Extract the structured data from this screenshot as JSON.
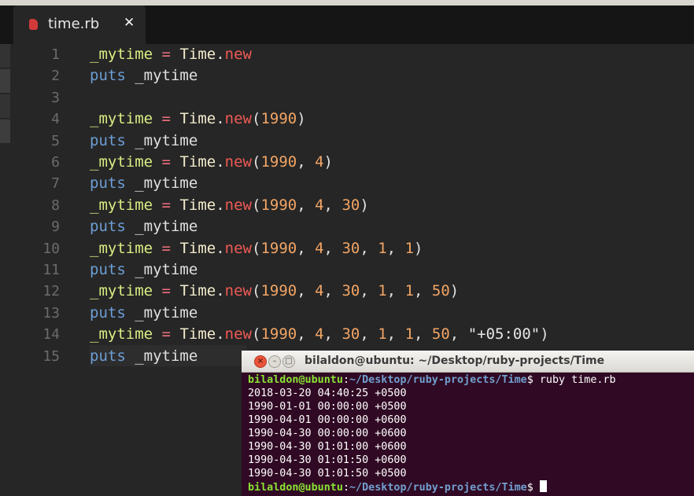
{
  "editor": {
    "tab": {
      "title": "time.rb",
      "close_glyph": "✕"
    },
    "line_numbers": [
      "1",
      "2",
      "3",
      "4",
      "5",
      "6",
      "7",
      "8",
      "9",
      "10",
      "11",
      "12",
      "13",
      "14",
      "15"
    ],
    "lines": [
      [
        [
          "v",
          "_mytime"
        ],
        [
          "p",
          " "
        ],
        [
          "o",
          "="
        ],
        [
          "p",
          " "
        ],
        [
          "c",
          "Time"
        ],
        [
          "p",
          "."
        ],
        [
          "m",
          "new"
        ]
      ],
      [
        [
          "k",
          "puts"
        ],
        [
          "p",
          " _mytime"
        ]
      ],
      [],
      [
        [
          "v",
          "_mytime"
        ],
        [
          "p",
          " "
        ],
        [
          "o",
          "="
        ],
        [
          "p",
          " "
        ],
        [
          "c",
          "Time"
        ],
        [
          "p",
          "."
        ],
        [
          "m",
          "new"
        ],
        [
          "p",
          "("
        ],
        [
          "n",
          "1990"
        ],
        [
          "p",
          ")"
        ]
      ],
      [
        [
          "k",
          "puts"
        ],
        [
          "p",
          " _mytime"
        ]
      ],
      [
        [
          "v",
          "_mytime"
        ],
        [
          "p",
          " "
        ],
        [
          "o",
          "="
        ],
        [
          "p",
          " "
        ],
        [
          "c",
          "Time"
        ],
        [
          "p",
          "."
        ],
        [
          "m",
          "new"
        ],
        [
          "p",
          "("
        ],
        [
          "n",
          "1990"
        ],
        [
          "p",
          ", "
        ],
        [
          "n",
          "4"
        ],
        [
          "p",
          ")"
        ]
      ],
      [
        [
          "k",
          "puts"
        ],
        [
          "p",
          " _mytime"
        ]
      ],
      [
        [
          "v",
          "_mytime"
        ],
        [
          "p",
          " "
        ],
        [
          "o",
          "="
        ],
        [
          "p",
          " "
        ],
        [
          "c",
          "Time"
        ],
        [
          "p",
          "."
        ],
        [
          "m",
          "new"
        ],
        [
          "p",
          "("
        ],
        [
          "n",
          "1990"
        ],
        [
          "p",
          ", "
        ],
        [
          "n",
          "4"
        ],
        [
          "p",
          ", "
        ],
        [
          "n",
          "30"
        ],
        [
          "p",
          ")"
        ]
      ],
      [
        [
          "k",
          "puts"
        ],
        [
          "p",
          " _mytime"
        ]
      ],
      [
        [
          "v",
          "_mytime"
        ],
        [
          "p",
          " "
        ],
        [
          "o",
          "="
        ],
        [
          "p",
          " "
        ],
        [
          "c",
          "Time"
        ],
        [
          "p",
          "."
        ],
        [
          "m",
          "new"
        ],
        [
          "p",
          "("
        ],
        [
          "n",
          "1990"
        ],
        [
          "p",
          ", "
        ],
        [
          "n",
          "4"
        ],
        [
          "p",
          ", "
        ],
        [
          "n",
          "30"
        ],
        [
          "p",
          ", "
        ],
        [
          "n",
          "1"
        ],
        [
          "p",
          ", "
        ],
        [
          "n",
          "1"
        ],
        [
          "p",
          ")"
        ]
      ],
      [
        [
          "k",
          "puts"
        ],
        [
          "p",
          " _mytime"
        ]
      ],
      [
        [
          "v",
          "_mytime"
        ],
        [
          "p",
          " "
        ],
        [
          "o",
          "="
        ],
        [
          "p",
          " "
        ],
        [
          "c",
          "Time"
        ],
        [
          "p",
          "."
        ],
        [
          "m",
          "new"
        ],
        [
          "p",
          "("
        ],
        [
          "n",
          "1990"
        ],
        [
          "p",
          ", "
        ],
        [
          "n",
          "4"
        ],
        [
          "p",
          ", "
        ],
        [
          "n",
          "30"
        ],
        [
          "p",
          ", "
        ],
        [
          "n",
          "1"
        ],
        [
          "p",
          ", "
        ],
        [
          "n",
          "1"
        ],
        [
          "p",
          ", "
        ],
        [
          "n",
          "50"
        ],
        [
          "p",
          ")"
        ]
      ],
      [
        [
          "k",
          "puts"
        ],
        [
          "p",
          " _mytime"
        ]
      ],
      [
        [
          "v",
          "_mytime"
        ],
        [
          "p",
          " "
        ],
        [
          "o",
          "="
        ],
        [
          "p",
          " "
        ],
        [
          "c",
          "Time"
        ],
        [
          "p",
          "."
        ],
        [
          "m",
          "new"
        ],
        [
          "p",
          "("
        ],
        [
          "n",
          "1990"
        ],
        [
          "p",
          ", "
        ],
        [
          "n",
          "4"
        ],
        [
          "p",
          ", "
        ],
        [
          "n",
          "30"
        ],
        [
          "p",
          ", "
        ],
        [
          "n",
          "1"
        ],
        [
          "p",
          ", "
        ],
        [
          "n",
          "1"
        ],
        [
          "p",
          ", "
        ],
        [
          "n",
          "50"
        ],
        [
          "p",
          ", "
        ],
        [
          "s",
          "\"+05:00\""
        ],
        [
          "p",
          ")"
        ]
      ],
      [
        [
          "k",
          "puts"
        ],
        [
          "p",
          " _mytime"
        ]
      ]
    ]
  },
  "terminal": {
    "title": "bilaldon@ubuntu: ~/Desktop/ruby-projects/Time",
    "prompt_user": "bilaldon@ubuntu",
    "prompt_sep": ":",
    "prompt_path": "~/Desktop/ruby-projects/Time",
    "prompt_symbol": "$",
    "command": " ruby time.rb",
    "output": [
      "2018-03-20 04:40:25 +0500",
      "1990-01-01 00:00:00 +0500",
      "1990-04-01 00:00:00 +0600",
      "1990-04-30 00:00:00 +0600",
      "1990-04-30 01:01:00 +0600",
      "1990-04-30 01:01:50 +0600",
      "1990-04-30 01:01:50 +0500"
    ],
    "buttons": {
      "close": "×",
      "minimize": "–",
      "maximize": "□"
    }
  },
  "colors": {
    "editor_bg": "#262626",
    "terminal_bg": "#300a24",
    "variable": "#d9ee83",
    "operator": "#f0707f",
    "keyword": "#6d9ed5",
    "number": "#f2a565",
    "method": "#f05a55"
  }
}
